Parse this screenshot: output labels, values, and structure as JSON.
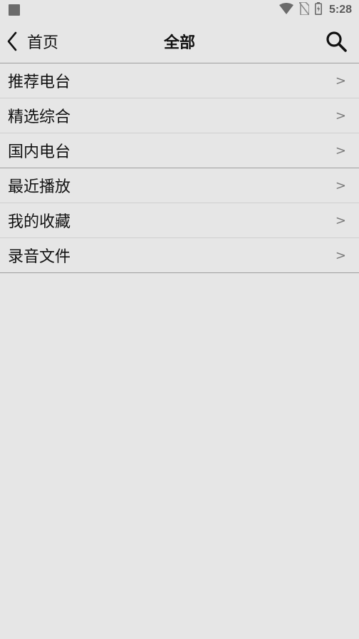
{
  "status_bar": {
    "time": "5:28",
    "icons": [
      "notification-square-icon",
      "wifi-icon",
      "no-sim-icon",
      "battery-charging-icon"
    ]
  },
  "header": {
    "back_label": "首页",
    "title": "全部",
    "back_icon": "chevron-left-icon",
    "search_icon": "search-icon"
  },
  "menu": {
    "items": [
      {
        "label": "推荐电台",
        "chevron": ">"
      },
      {
        "label": "精选综合",
        "chevron": ">"
      },
      {
        "label": "国内电台",
        "chevron": ">"
      },
      {
        "label": "最近播放",
        "chevron": ">"
      },
      {
        "label": "我的收藏",
        "chevron": ">"
      },
      {
        "label": "录音文件",
        "chevron": ">"
      }
    ]
  },
  "colors": {
    "background": "#e6e6e6",
    "text": "#111111",
    "divider": "#cfcfcf",
    "strong_divider": "#9e9e9e"
  }
}
